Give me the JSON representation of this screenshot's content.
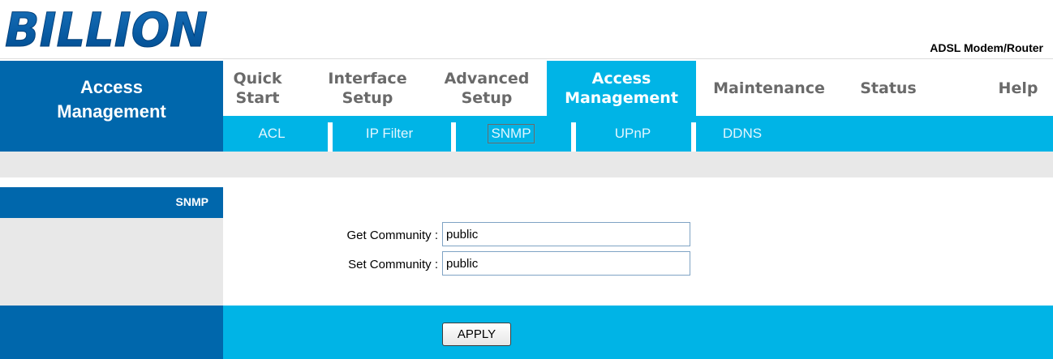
{
  "header": {
    "logo_text": "BILLION",
    "product_name": "ADSL Modem/Router"
  },
  "left_panel": {
    "title_line1": "Access",
    "title_line2": "Management",
    "section_label": "SNMP"
  },
  "main_nav": [
    {
      "line1": "Quick",
      "line2": "Start"
    },
    {
      "line1": "Interface",
      "line2": "Setup"
    },
    {
      "line1": "Advanced",
      "line2": "Setup"
    },
    {
      "line1": "Access",
      "line2": "Management",
      "active": true
    },
    {
      "line1": "Maintenance",
      "line2": ""
    },
    {
      "line1": "Status",
      "line2": ""
    },
    {
      "line1": "Help",
      "line2": ""
    }
  ],
  "sub_nav": [
    {
      "label": "ACL"
    },
    {
      "label": "IP Filter"
    },
    {
      "label": "SNMP",
      "active": true
    },
    {
      "label": "UPnP"
    },
    {
      "label": "DDNS"
    }
  ],
  "form": {
    "get_community_label": "Get Community :",
    "get_community_value": "public",
    "set_community_label": "Set Community :",
    "set_community_value": "public",
    "apply_label": "APPLY"
  },
  "colors": {
    "dark_blue": "#0067ac",
    "light_blue": "#00b4e6",
    "grey": "#e8e8e8"
  }
}
